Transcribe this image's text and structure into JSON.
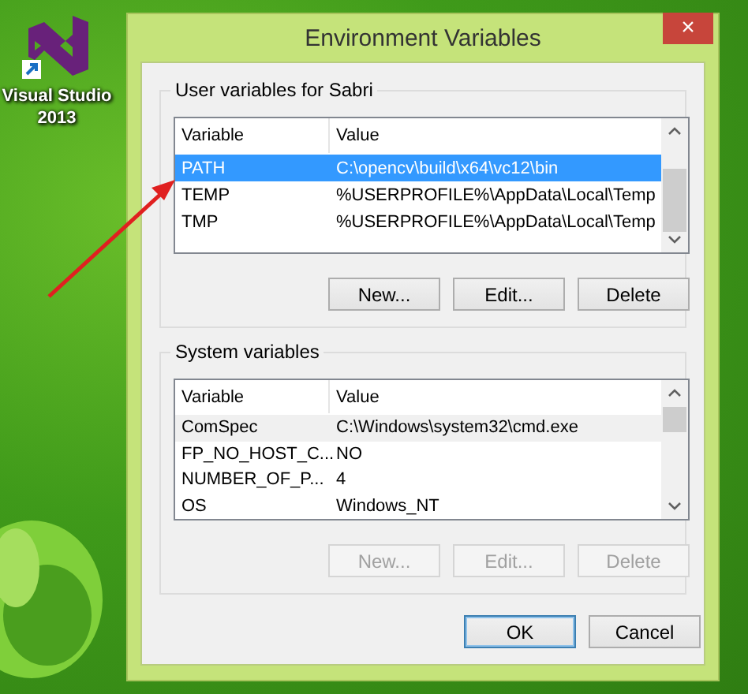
{
  "desktop_icon": {
    "label": "Visual Studio 2013"
  },
  "window": {
    "title": "Environment Variables",
    "close": "×"
  },
  "groups": [
    {
      "title": "User variables for Sabri",
      "focused": true,
      "columns": [
        "Variable",
        "Value"
      ],
      "rows": [
        {
          "variable": "PATH",
          "value": "C:\\opencv\\build\\x64\\vc12\\bin",
          "selected": true
        },
        {
          "variable": "TEMP",
          "value": "%USERPROFILE%\\AppData\\Local\\Temp",
          "selected": false
        },
        {
          "variable": "TMP",
          "value": "%USERPROFILE%\\AppData\\Local\\Temp",
          "selected": false
        }
      ],
      "buttons": [
        {
          "label": "New...",
          "disabled": false
        },
        {
          "label": "Edit...",
          "disabled": false
        },
        {
          "label": "Delete",
          "disabled": false
        }
      ]
    },
    {
      "title": "System variables",
      "focused": false,
      "columns": [
        "Variable",
        "Value"
      ],
      "rows": [
        {
          "variable": "ComSpec",
          "value": "C:\\Windows\\system32\\cmd.exe",
          "selected": true
        },
        {
          "variable": "FP_NO_HOST_C...",
          "value": "NO",
          "selected": false
        },
        {
          "variable": "NUMBER_OF_P...",
          "value": "4",
          "selected": false
        },
        {
          "variable": "OS",
          "value": "Windows_NT",
          "selected": false
        }
      ],
      "buttons": [
        {
          "label": "New...",
          "disabled": true
        },
        {
          "label": "Edit...",
          "disabled": true
        },
        {
          "label": "Delete",
          "disabled": true
        }
      ]
    }
  ],
  "buttons": [
    {
      "label": "OK",
      "default": true
    },
    {
      "label": "Cancel",
      "default": false
    }
  ]
}
